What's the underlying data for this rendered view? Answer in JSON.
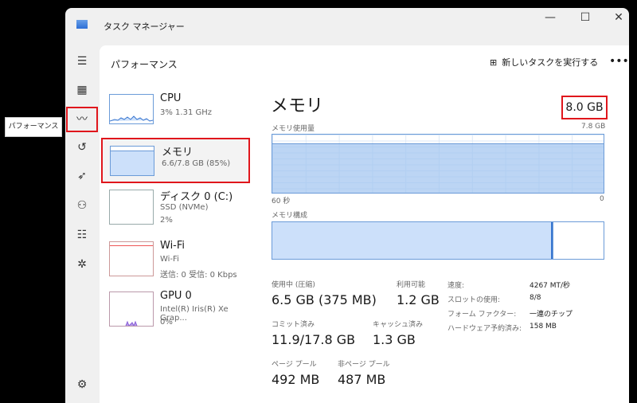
{
  "window": {
    "title": "タスク マネージャー",
    "minimize": "—",
    "maximize": "☐",
    "close": "✕"
  },
  "tooltip": "パフォーマンス",
  "header": {
    "title": "パフォーマンス",
    "run_task": "新しいタスクを実行する",
    "more": "•••"
  },
  "resources": [
    {
      "name": "CPU",
      "sub1": "3%  1.31 GHz"
    },
    {
      "name": "メモリ",
      "sub1": "6.6/7.8 GB (85%)"
    },
    {
      "name": "ディスク 0 (C:)",
      "sub1": "SSD (NVMe)",
      "sub2": "2%"
    },
    {
      "name": "Wi-Fi",
      "sub1": "Wi-Fi",
      "sub2": "送信: 0  受信: 0 Kbps"
    },
    {
      "name": "GPU 0",
      "sub1": "Intel(R) Iris(R) Xe Grap...",
      "sub2": "0%"
    }
  ],
  "memory": {
    "title": "メモリ",
    "total": "8.0 GB",
    "usage_label": "メモリ使用量",
    "usage_max": "7.8 GB",
    "time_left": "60 秒",
    "time_right": "0",
    "usage_percent": 85,
    "composition_label": "メモリ構成",
    "stats": [
      {
        "label": "使用中 (圧縮)",
        "value": "6.5 GB (375 MB)"
      },
      {
        "label": "利用可能",
        "value": "1.2 GB"
      },
      {
        "label": "コミット済み",
        "value": "11.9/17.8 GB"
      },
      {
        "label": "キャッシュ済み",
        "value": "1.3 GB"
      },
      {
        "label": "ページ プール",
        "value": "492 MB"
      },
      {
        "label": "非ページ プール",
        "value": "487 MB"
      }
    ],
    "details": [
      {
        "label": "速度:",
        "value": "4267 MT/秒"
      },
      {
        "label": "スロットの使用:",
        "value": "8/8"
      },
      {
        "label": "フォーム ファクター:",
        "value": "一連のチップ"
      },
      {
        "label": "ハードウェア予約済み:",
        "value": "158 MB"
      }
    ]
  },
  "colors": {
    "memory": "#cce0fa",
    "memory_line": "#6b9bd8",
    "highlight": "#e0161c"
  }
}
